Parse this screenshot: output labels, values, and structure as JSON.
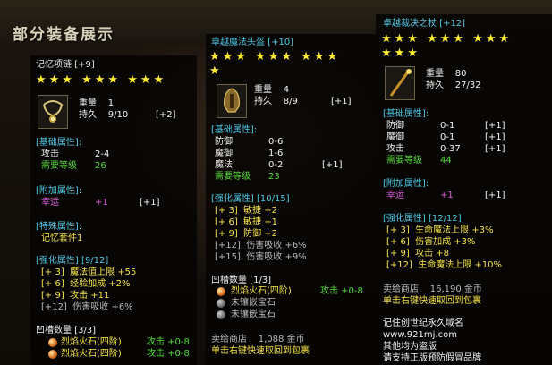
{
  "header": {
    "title": "部分装备展示"
  },
  "necklace": {
    "name": "记忆项链",
    "upgrade": "[+9]",
    "stars_row1": "★★★ ★★★ ★★★",
    "icon": "necklace-icon",
    "weight_label": "重量",
    "weight_value": "1",
    "dur_label": "持久",
    "dur_value": "9/10",
    "dur_plus": "[+2]",
    "basic_title": "[基础属性]:",
    "attack_label": "攻击",
    "attack_value": "2-4",
    "req_label": "需要等级",
    "req_value": "26",
    "extra_title": "[附加属性]:",
    "luck_label": "幸运",
    "luck_value": "+1",
    "luck_plus": "[+1]",
    "special_title": "[特殊属性]:",
    "special_value": "记忆套件1",
    "enhance_title": "[强化属性] [9/12]",
    "enhance": [
      {
        "lvl": "[+ 3]",
        "text": "魔法值上限 +55"
      },
      {
        "lvl": "[+ 6]",
        "text": "经验加成 +2%"
      },
      {
        "lvl": "[+ 9]",
        "text": "攻击 +11"
      },
      {
        "lvl": "[+12]",
        "text": "伤害吸收 +6%"
      }
    ],
    "socket_title": "凹槽数量 [3/3]",
    "sockets": [
      {
        "gem": "烈焰火石(四阶)",
        "stat": "攻击 +0-8"
      },
      {
        "gem": "烈焰火石(四阶)",
        "stat": "攻击 +0-8"
      }
    ]
  },
  "helmet": {
    "name": "卓越魔法头盔 [+10]",
    "stars_row1": "★★★ ★★★ ★★★",
    "stars_row2": "★",
    "icon": "helmet-icon",
    "weight_label": "重量",
    "weight_value": "4",
    "dur_label": "持久",
    "dur_value": "8/9",
    "dur_plus": "[+1]",
    "basic_title": "[基础属性]:",
    "basic": [
      {
        "label": "防御",
        "value": "0-6"
      },
      {
        "label": "魔御",
        "value": "1-6"
      },
      {
        "label": "魔法",
        "value": "0-2",
        "plus": "[+1]"
      }
    ],
    "req_label": "需要等级",
    "req_value": "23",
    "enhance_title": "[强化属性] [10/15]",
    "enhance": [
      {
        "lvl": "[+ 3]",
        "text": "敏捷 +2"
      },
      {
        "lvl": "[+ 6]",
        "text": "敏捷 +1"
      },
      {
        "lvl": "[+ 9]",
        "text": "防御 +2"
      },
      {
        "lvl": "[+12]",
        "text": "伤害吸收 +6%"
      },
      {
        "lvl": "[+15]",
        "text": "伤害吸收 +9%"
      }
    ],
    "socket_title": "凹槽数量 [1/3]",
    "sockets": [
      {
        "gem": "烈焰火石(四阶)",
        "stat": "攻击 +0-8",
        "type": "fire"
      },
      {
        "gem": "未镶嵌宝石",
        "stat": "",
        "type": "empty"
      },
      {
        "gem": "未镶嵌宝石",
        "stat": "",
        "type": "empty"
      }
    ],
    "shop_label": "卖给商店",
    "shop_value": "1,088 金币",
    "hint": "单击右键快速取回到包裹"
  },
  "staff": {
    "name": "卓越裁决之杖 [+12]",
    "stars_row1": "★★★ ★★★ ★★★",
    "stars_row2": "★★★",
    "icon": "staff-icon",
    "weight_label": "重量",
    "weight_value": "80",
    "dur_label": "持久",
    "dur_value": "27/32",
    "basic_title": "[基础属性]:",
    "basic": [
      {
        "label": "防御",
        "value": "0-1",
        "plus": "[+1]"
      },
      {
        "label": "魔御",
        "value": "0-1",
        "plus": "[+1]"
      },
      {
        "label": "攻击",
        "value": "0-37",
        "plus": "[+1]"
      }
    ],
    "req_label": "需要等级",
    "req_value": "44",
    "extra_title": "[附加属性]:",
    "luck_label": "幸运",
    "luck_value": "+1",
    "luck_plus": "[+1]",
    "enhance_title": "[强化属性] [12/12]",
    "enhance": [
      {
        "lvl": "[+ 3]",
        "text": "生命魔法上限 +3%"
      },
      {
        "lvl": "[+ 6]",
        "text": "伤害加成 +3%"
      },
      {
        "lvl": "[+ 9]",
        "text": "攻击 +8"
      },
      {
        "lvl": "[+12]",
        "text": "生命魔法上限 +10%"
      }
    ],
    "shop_label": "卖给商店",
    "shop_value": "16,190 金币",
    "hint": "单击右键快速取回到包裹",
    "footer": [
      "记住创世纪永久域名",
      "www.921mj.com",
      "其他均为盗版",
      "请支持正版预防假冒品牌"
    ]
  },
  "colors": {
    "gold": "#f4e24a",
    "cyan": "#4fc7e6",
    "green": "#58d83c",
    "purple": "#e05fe3",
    "star": "#ffee33"
  }
}
